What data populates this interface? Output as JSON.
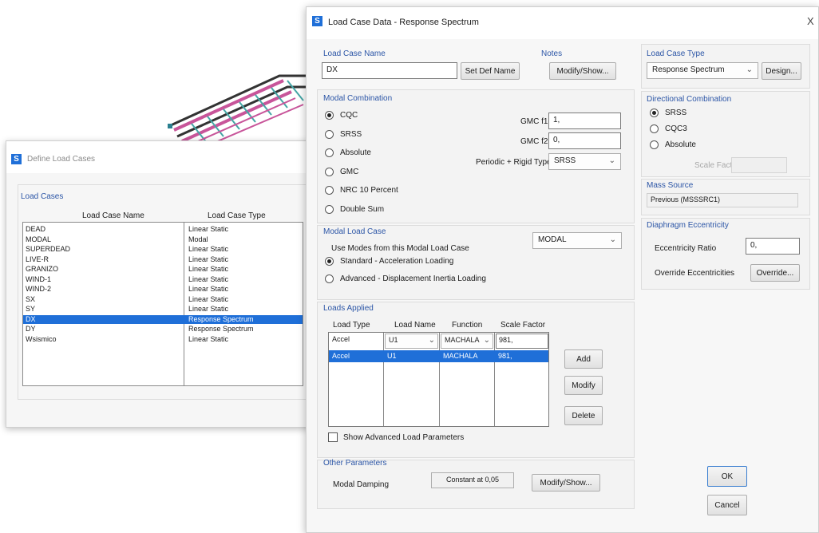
{
  "define_dialog": {
    "title": "Define Load Cases",
    "group_title": "Load Cases",
    "col_name": "Load Case Name",
    "col_type": "Load Case Type",
    "rows": [
      {
        "name": "DEAD",
        "type": "Linear Static"
      },
      {
        "name": "MODAL",
        "type": "Modal"
      },
      {
        "name": "SUPERDEAD",
        "type": "Linear Static"
      },
      {
        "name": "LIVE-R",
        "type": "Linear Static"
      },
      {
        "name": "GRANIZO",
        "type": "Linear Static"
      },
      {
        "name": "WIND-1",
        "type": "Linear Static"
      },
      {
        "name": "WIND-2",
        "type": "Linear Static"
      },
      {
        "name": "SX",
        "type": "Linear Static"
      },
      {
        "name": "SY",
        "type": "Linear Static"
      },
      {
        "name": "DX",
        "type": "Response Spectrum"
      },
      {
        "name": "DY",
        "type": "Response Spectrum"
      },
      {
        "name": "Wsismico",
        "type": "Linear Static"
      }
    ],
    "selected_row": 9
  },
  "main_dialog": {
    "title": "Load Case Data - Response Spectrum",
    "close": "X",
    "load_case_name": {
      "label": "Load Case Name",
      "value": "DX",
      "set_def_name": "Set Def Name"
    },
    "notes": {
      "label": "Notes",
      "button": "Modify/Show..."
    },
    "load_case_type": {
      "label": "Load Case Type",
      "value": "Response Spectrum",
      "design_button": "Design..."
    },
    "modal_combination": {
      "title": "Modal Combination",
      "options": [
        "CQC",
        "SRSS",
        "Absolute",
        "GMC",
        "NRC 10 Percent",
        "Double Sum"
      ],
      "selected": "CQC",
      "gmc_f1_label": "GMC f1",
      "gmc_f1_value": "1,",
      "gmc_f2_label": "GMC f2",
      "gmc_f2_value": "0,",
      "periodic_label": "Periodic + Rigid Type",
      "periodic_value": "SRSS"
    },
    "directional_combination": {
      "title": "Directional Combination",
      "options": [
        "SRSS",
        "CQC3",
        "Absolute"
      ],
      "selected": "SRSS",
      "scale_factor_label": "Scale Factor"
    },
    "mass_source": {
      "title": "Mass Source",
      "value": "Previous (MSSSRC1)"
    },
    "diaphragm": {
      "title": "Diaphragm Eccentricity",
      "ratio_label": "Eccentricity Ratio",
      "ratio_value": "0,",
      "override_label": "Override Eccentricities",
      "override_button": "Override..."
    },
    "modal_load_case": {
      "title": "Modal Load Case",
      "use_modes_label": "Use Modes from this Modal Load Case",
      "use_modes_value": "MODAL",
      "options": [
        "Standard - Acceleration Loading",
        "Advanced - Displacement Inertia Loading"
      ],
      "selected": "Standard - Acceleration Loading"
    },
    "loads_applied": {
      "title": "Loads Applied",
      "headers": [
        "Load Type",
        "Load Name",
        "Function",
        "Scale Factor"
      ],
      "edit_row": [
        "Accel",
        "U1",
        "MACHALA",
        "981,"
      ],
      "rows": [
        [
          "Accel",
          "U1",
          "MACHALA",
          "981,"
        ]
      ],
      "add": "Add",
      "modify": "Modify",
      "delete": "Delete",
      "show_advanced": "Show Advanced Load Parameters"
    },
    "other_parameters": {
      "title": "Other Parameters",
      "damping_label": "Modal Damping",
      "damping_value": "Constant at 0,05",
      "button": "Modify/Show..."
    },
    "ok": "OK",
    "cancel": "Cancel"
  },
  "colors": {
    "accent": "#2b55a6",
    "selection": "#1f6fd8",
    "group_bg": "#f3f3f3"
  }
}
